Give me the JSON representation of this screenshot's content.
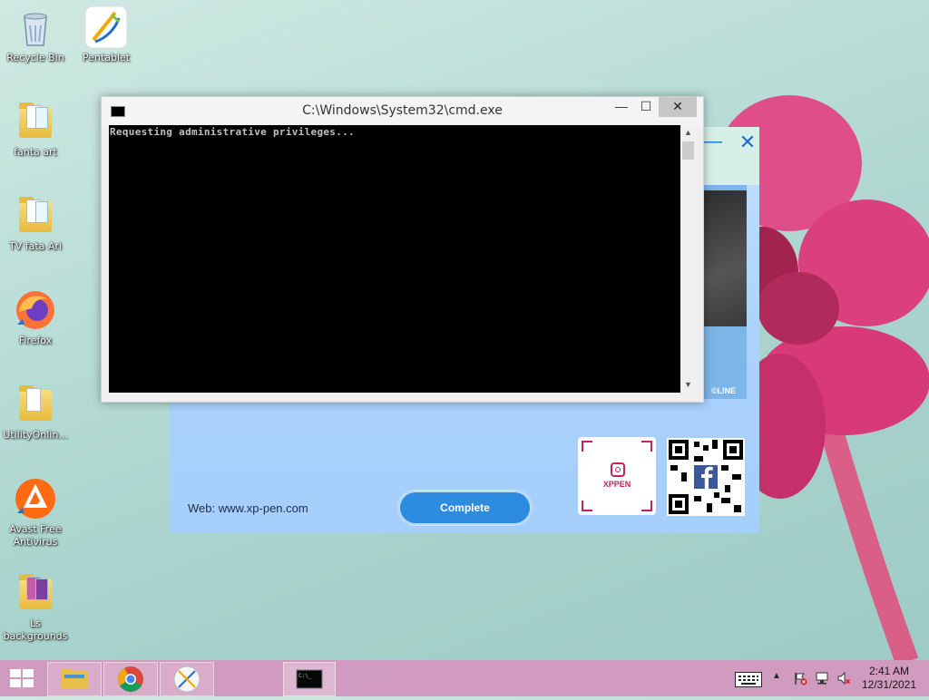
{
  "desktop": {
    "icons": [
      {
        "label": "Recycle Bin",
        "icon": "recycle-bin-icon"
      },
      {
        "label": "Pentablet",
        "icon": "pentablet-icon"
      },
      {
        "label": "fanta art",
        "icon": "folder-icon"
      },
      {
        "label": "TV  fata Ari",
        "icon": "folder-icon"
      },
      {
        "label": "Firefox",
        "icon": "firefox-icon"
      },
      {
        "label": "UtilityOnlin...",
        "icon": "folder-icon"
      },
      {
        "label": "Avast Free\nAntivirus",
        "icon": "avast-icon"
      },
      {
        "label": "Ls\nbackgrounds",
        "icon": "folder-icon"
      }
    ]
  },
  "installer": {
    "web_text": "Web: www.xp-pen.com",
    "complete_label": "Complete",
    "brand": "XPPEN",
    "copyright": "©LINE",
    "minimize": "—",
    "close": "✕"
  },
  "cmd": {
    "title": "C:\\Windows\\System32\\cmd.exe",
    "output": "Requesting administrative privileges...",
    "minimize": "—",
    "maximize": "☐",
    "close": "✕"
  },
  "taskbar": {
    "items": [
      "file-explorer",
      "chrome",
      "pentablet",
      "cmd"
    ],
    "time": "2:41 AM",
    "date": "12/31/2021"
  },
  "colors": {
    "taskbar": "#d39ac0",
    "complete_button": "#2d8be0",
    "installer_accent": "#1c6dd0"
  }
}
